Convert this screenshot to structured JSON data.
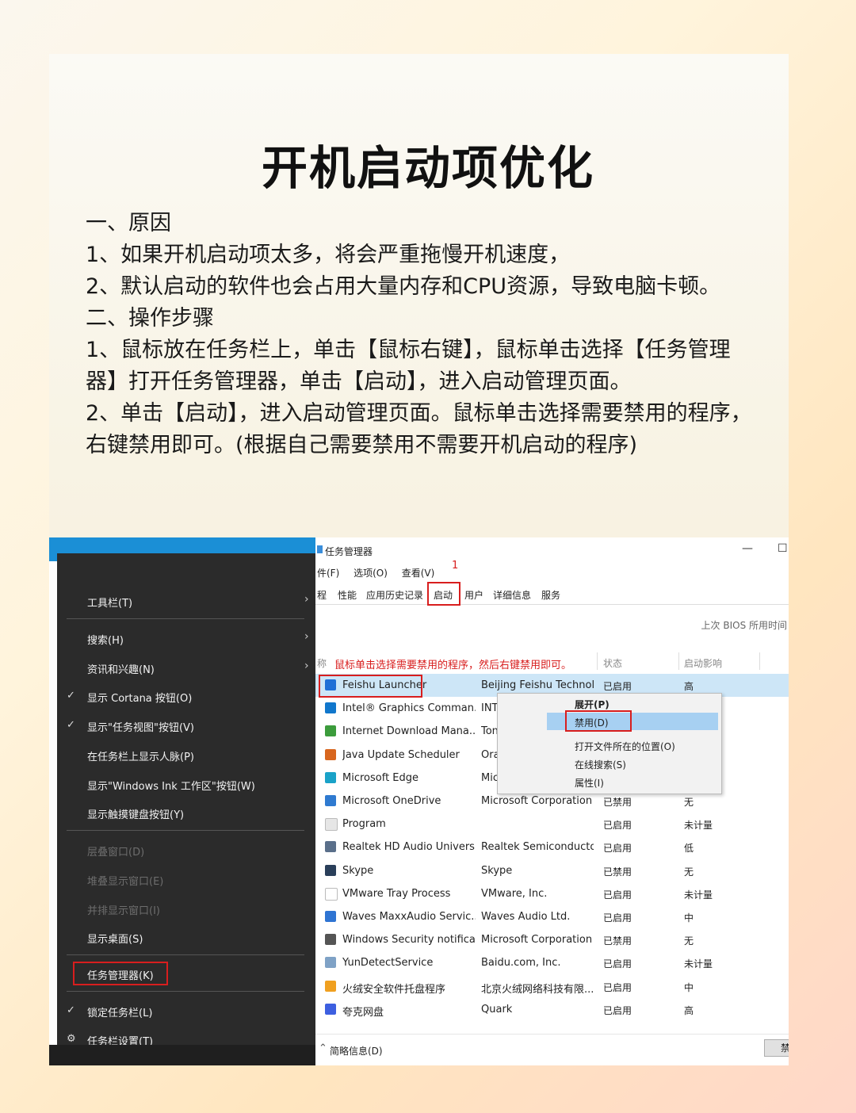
{
  "title": "开机启动项优化",
  "paragraphs": [
    "一、原因",
    "1、如果开机启动项太多，将会严重拖慢开机速度，",
    "2、默认启动的软件也会占用大量内存和CPU资源，导致电脑卡顿。",
    "二、操作步骤",
    "1、鼠标放在任务栏上，单击【鼠标右键】，鼠标单击选择【任务管理器】打开任务管理器，单击【启动】，进入启动管理页面。",
    "2、单击【启动】，进入启动管理页面。鼠标单击选择需要禁用的程序，右键禁用即可。(根据自己需要禁用不需要开机启动的程序)"
  ],
  "context_menu": {
    "items": [
      {
        "label": "工具栏(T)",
        "arrow": "›"
      },
      {
        "label": "搜索(H)",
        "arrow": "›"
      },
      {
        "label": "资讯和兴趣(N)",
        "arrow": "›"
      },
      {
        "label": "显示 Cortana 按钮(O)",
        "check": "✓"
      },
      {
        "label": "显示\"任务视图\"按钮(V)",
        "check": "✓"
      },
      {
        "label": "在任务栏上显示人脉(P)"
      },
      {
        "label": "显示\"Windows Ink 工作区\"按钮(W)"
      },
      {
        "label": "显示触摸键盘按钮(Y)"
      },
      {
        "label": "层叠窗口(D)",
        "disabled": true
      },
      {
        "label": "堆叠显示窗口(E)",
        "disabled": true
      },
      {
        "label": "并排显示窗口(I)",
        "disabled": true
      },
      {
        "label": "显示桌面(S)"
      },
      {
        "label": "任务管理器(K)"
      },
      {
        "label": "锁定任务栏(L)",
        "check": "✓"
      },
      {
        "label": "任务栏设置(T)",
        "check": "⚙"
      }
    ]
  },
  "task_manager": {
    "window_title": "任务管理器",
    "minimize": "—",
    "maximize": "☐",
    "menu": [
      "件(F)",
      "选项(O)",
      "查看(V)"
    ],
    "step_marker": "1",
    "tabs": [
      "程",
      "性能",
      "应用历史记录",
      "启动",
      "用户",
      "详细信息",
      "服务"
    ],
    "active_tab": "启动",
    "bios_label": "上次 BIOS 所用时间",
    "col_name_partial": "称",
    "annotation": "鼠标单击选择需要禁用的程序，然后右键禁用即可。",
    "col_status": "状态",
    "col_impact": "启动影响",
    "rows": [
      {
        "name": "Feishu Launcher",
        "publisher": "Beijing Feishu Technol...",
        "status": "已启用",
        "impact": "高",
        "color": "#1f6fd6"
      },
      {
        "name": "Intel® Graphics Comman...",
        "publisher": "INTEL CORP",
        "status": "",
        "impact": "",
        "color": "#1177cc"
      },
      {
        "name": "Internet Download Mana...",
        "publisher": "Tonec Inc.",
        "status": "",
        "impact": "",
        "color": "#3c9c3c"
      },
      {
        "name": "Java Update Scheduler",
        "publisher": "Oracle Corpo",
        "status": "",
        "impact": "",
        "color": "#d8661e"
      },
      {
        "name": "Microsoft Edge",
        "publisher": "Microsoft Cor",
        "status": "",
        "impact": "",
        "color": "#1aa2c8"
      },
      {
        "name": "Microsoft OneDrive",
        "publisher": "Microsoft Corporation",
        "status": "已禁用",
        "impact": "无",
        "color": "#2f7ad0"
      },
      {
        "name": "Program",
        "publisher": "",
        "status": "已启用",
        "impact": "未计量",
        "color": "#e6e6e6"
      },
      {
        "name": "Realtek HD Audio Univers...",
        "publisher": "Realtek Semiconductor",
        "status": "已启用",
        "impact": "低",
        "color": "#5a6f8a"
      },
      {
        "name": "Skype",
        "publisher": "Skype",
        "status": "已禁用",
        "impact": "无",
        "color": "#2a3f5a"
      },
      {
        "name": "VMware Tray Process",
        "publisher": "VMware, Inc.",
        "status": "已启用",
        "impact": "未计量",
        "color": "#ffffff"
      },
      {
        "name": "Waves MaxxAudio Servic...",
        "publisher": "Waves Audio Ltd.",
        "status": "已启用",
        "impact": "中",
        "color": "#2f74d2"
      },
      {
        "name": "Windows Security notifica...",
        "publisher": "Microsoft Corporation",
        "status": "已禁用",
        "impact": "无",
        "color": "#555555"
      },
      {
        "name": "YunDetectService",
        "publisher": "Baidu.com, Inc.",
        "status": "已启用",
        "impact": "未计量",
        "color": "#7fa2c6"
      },
      {
        "name": "火绒安全软件托盘程序",
        "publisher": "北京火绒网络科技有限...",
        "status": "已启用",
        "impact": "中",
        "color": "#f0a020"
      },
      {
        "name": "夸克网盘",
        "publisher": "Quark",
        "status": "已启用",
        "impact": "高",
        "color": "#3d5fe0"
      }
    ],
    "fewer_details": "简略信息(D)",
    "disable_button_partial": "禁"
  },
  "row_menu": {
    "items": [
      "展开(P)",
      "禁用(D)",
      "打开文件所在的位置(O)",
      "在线搜索(S)",
      "属性(I)"
    ],
    "highlighted": "禁用(D)"
  }
}
